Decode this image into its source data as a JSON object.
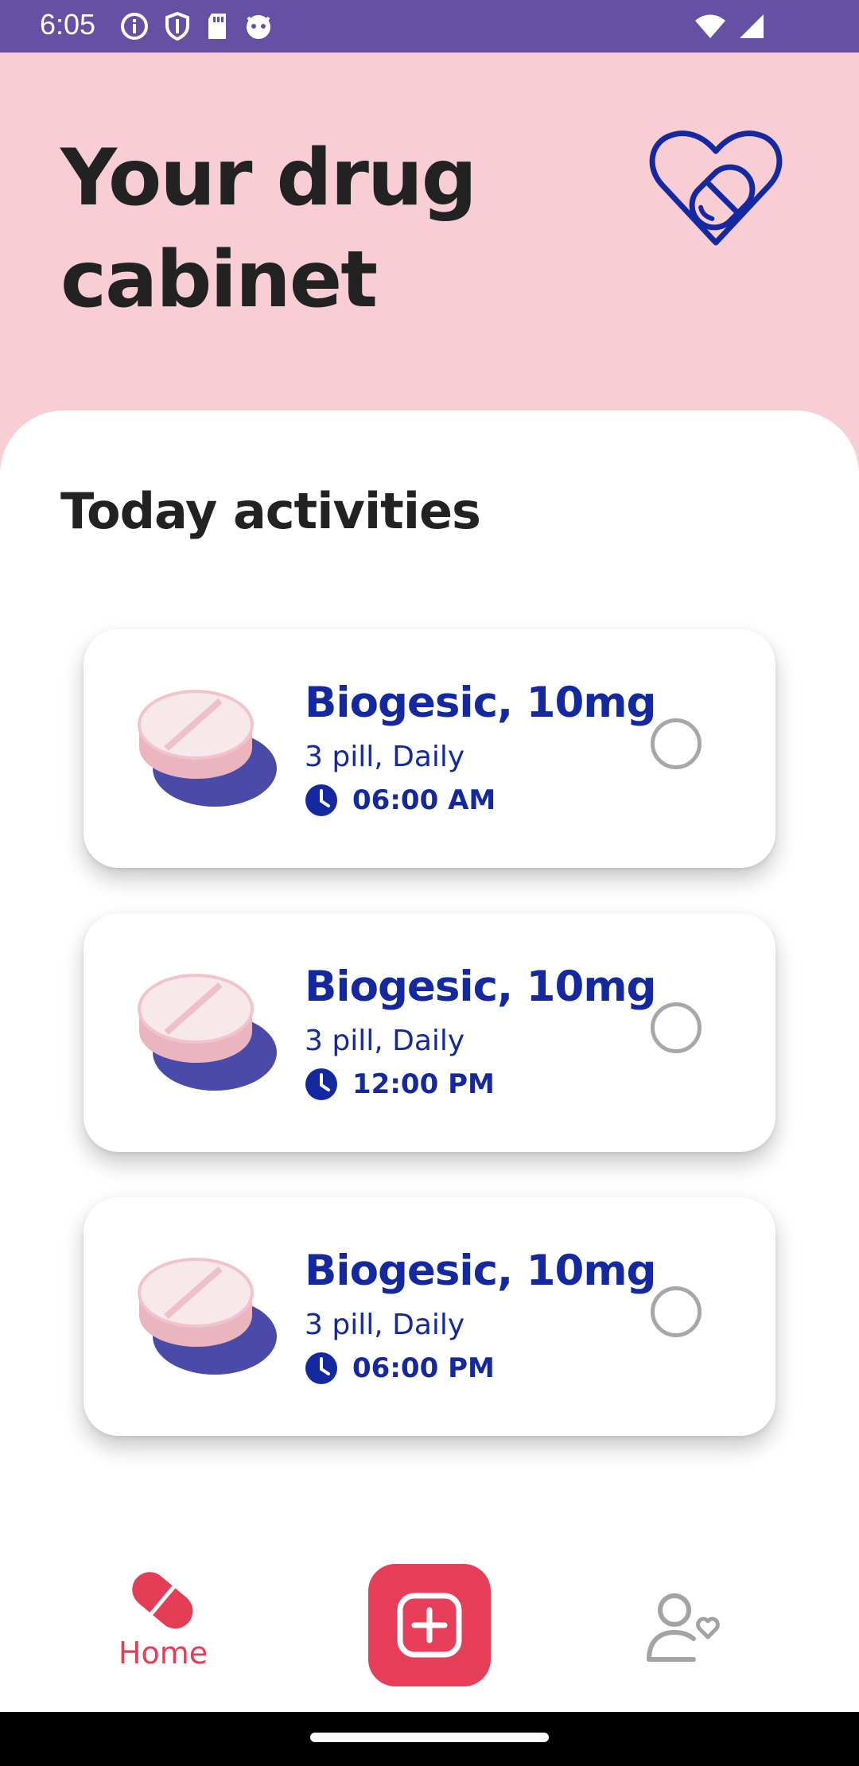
{
  "status_bar": {
    "time": "6:05",
    "icons": [
      "info-icon",
      "shield-icon",
      "sd-card-icon",
      "cat-face-icon",
      "wifi-icon",
      "cell-signal-icon"
    ],
    "color": "#6650a4"
  },
  "header": {
    "title": "Your drug cabinet",
    "logo_icon": "heart-pill-icon",
    "background": "#f8cdd4"
  },
  "section": {
    "title": "Today activities"
  },
  "activities": [
    {
      "name": "Biogesic, 10mg",
      "dose": "3 pill, Daily",
      "time": "06:00 AM",
      "checked": false
    },
    {
      "name": "Biogesic, 10mg",
      "dose": "3 pill, Daily",
      "time": "12:00 PM",
      "checked": false
    },
    {
      "name": "Biogesic, 10mg",
      "dose": "3 pill, Daily",
      "time": "06:00 PM",
      "checked": false
    }
  ],
  "bottom_nav": {
    "home_label": "Home",
    "home_icon": "capsule-icon",
    "add_icon": "add-square-icon",
    "profile_icon": "user-heart-icon",
    "accent": "#e63e58"
  },
  "colors": {
    "primary_text": "#1429a0",
    "heading_text": "#222222",
    "pill_pink": "#f2bfc8",
    "pill_shadow": "#4a4aa8"
  }
}
